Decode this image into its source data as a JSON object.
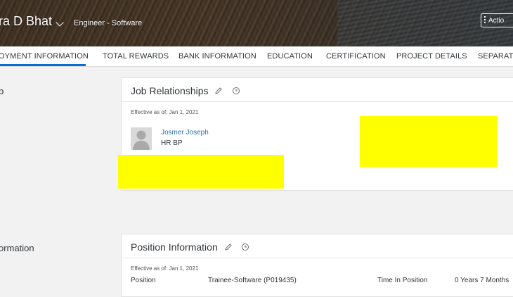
{
  "header": {
    "person_name": "ra D Bhat",
    "person_title": "Engineer - Software",
    "actions_label": "Actio"
  },
  "tabs": [
    {
      "label": "OYMENT INFORMATION",
      "active": true
    },
    {
      "label": "TOTAL REWARDS"
    },
    {
      "label": "BANK INFORMATION"
    },
    {
      "label": "EDUCATION"
    },
    {
      "label": "CERTIFICATION"
    },
    {
      "label": "PROJECT DETAILS"
    },
    {
      "label": "SEPARATIO"
    }
  ],
  "left_labels": {
    "job_section": "b",
    "position_section": "ormation"
  },
  "job_relationships": {
    "title": "Job Relationships",
    "effective": "Effective as of: Jan 1, 2021",
    "person_name": "Josmer Joseph",
    "role": "HR BP"
  },
  "position_information": {
    "title": "Position Information",
    "effective": "Effective as of: Jan 1, 2021",
    "position_label": "Position",
    "position_value": "Trainee-Software (P019435)",
    "time_label": "Time In Position",
    "time_value": "0 Years 7 Months"
  },
  "colors": {
    "accent": "#0a6ed1",
    "link": "#2a6fb0",
    "redaction": "#ffff00"
  },
  "icons": [
    "chevron-down-icon",
    "more-vertical-icon",
    "pencil-icon",
    "history-icon",
    "avatar-placeholder-icon"
  ]
}
